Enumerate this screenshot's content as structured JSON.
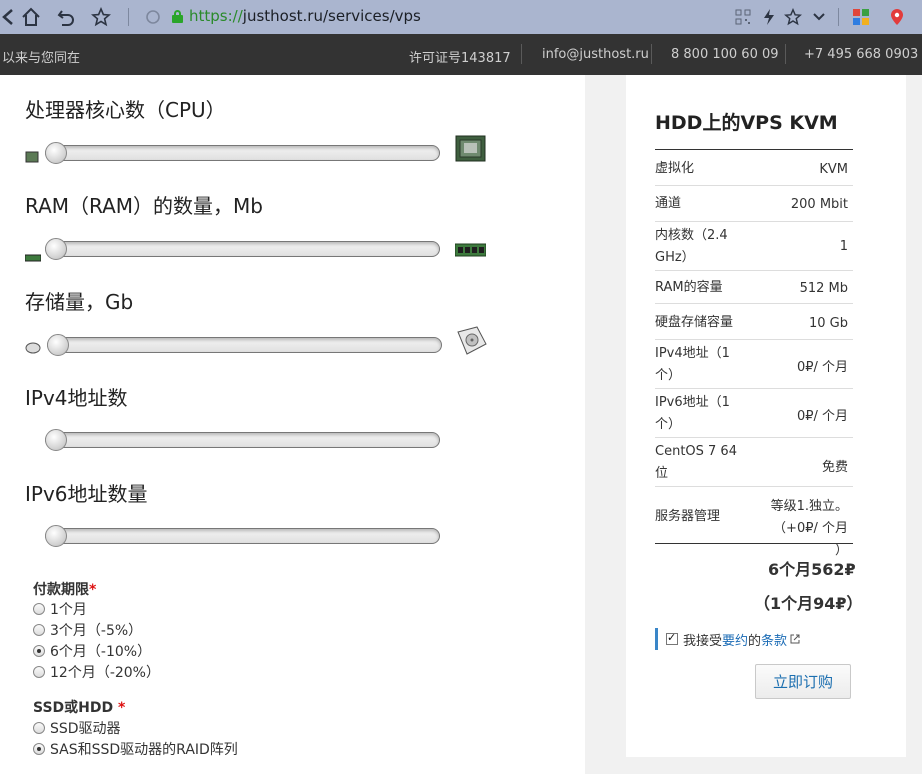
{
  "browser": {
    "url_scheme": "https://",
    "url_rest": "justhost.ru/services/vps"
  },
  "site_bar": {
    "left_text": "以来与您同在",
    "license": "许可证号143817",
    "email": "info@justhost.ru",
    "phone1": "8 800 100 60 09",
    "phone2": "+7 495 668 0903"
  },
  "config": {
    "cpu_title": "处理器核心数（CPU）",
    "ram_title": "RAM（RAM）的数量，Mb",
    "storage_title": "存储量，Gb",
    "ipv4_title": "IPv4地址数",
    "ipv6_title": "IPv6地址数量",
    "sliders": [
      {
        "name": "cpu",
        "value": 0
      },
      {
        "name": "ram",
        "value": 0
      },
      {
        "name": "storage",
        "value": 0
      },
      {
        "name": "ipv4",
        "value": 0
      },
      {
        "name": "ipv6",
        "value": 0
      }
    ]
  },
  "payment": {
    "label": "付款期限",
    "required_mark": "*",
    "options": [
      {
        "label": "1个月",
        "checked": false
      },
      {
        "label": "3个月（-5%）",
        "checked": false
      },
      {
        "label": "6个月（-10%）",
        "checked": true
      },
      {
        "label": "12个月（-20%）",
        "checked": false
      }
    ]
  },
  "disk": {
    "label": "SSD或HDD",
    "required_mark": "*",
    "options": [
      {
        "label": "SSD驱动器",
        "checked": false
      },
      {
        "label": "SAS和SSD驱动器的RAID阵列",
        "checked": true
      }
    ]
  },
  "summary": {
    "title": "HDD上的VPS KVM",
    "rows": [
      {
        "key": "虚拟化",
        "value": "KVM"
      },
      {
        "key": "通道",
        "value": "200 Mbit"
      },
      {
        "key": "内核数（2.4 GHz）",
        "value": "1"
      },
      {
        "key": "RAM的容量",
        "value": "512 Mb"
      },
      {
        "key": "硬盘存储容量",
        "value": "10 Gb"
      },
      {
        "key": "IPv4地址（1个）",
        "value": "0₽/ 个月"
      },
      {
        "key": "IPv6地址（1个）",
        "value": "0₽/ 个月"
      },
      {
        "key": "CentOS 7 64位",
        "value": "免费"
      },
      {
        "key": "服务器管理",
        "value": "等级1.独立。（+0₽/ 个月 ）"
      }
    ],
    "total_period": "6个月562₽",
    "total_monthly": "（1个月94₽）",
    "terms_prefix": "我接受",
    "terms_link1": "要约",
    "terms_mid": "的",
    "terms_link2": "条款",
    "terms_checked": true,
    "order_button": "立即订购"
  },
  "colors": {
    "browser_bar": "#aab5cf",
    "site_bar": "#333333",
    "link": "#1a6bb5",
    "terms_accent": "#3a86c8"
  }
}
